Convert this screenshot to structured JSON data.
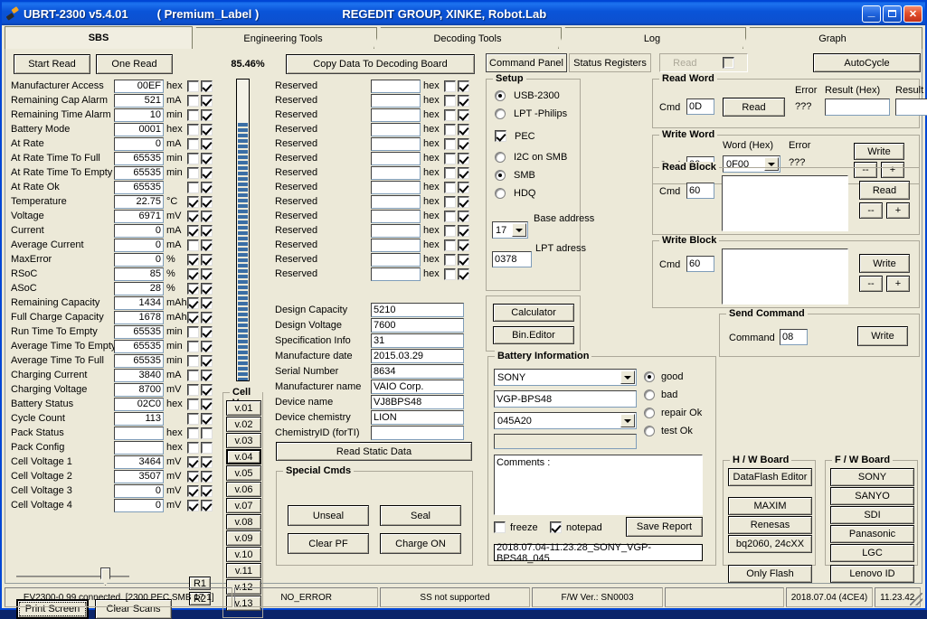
{
  "titlebar": {
    "app_title": "UBRT-2300 v5.4.01",
    "label": "( Premium_Label )",
    "group": "REGEDIT GROUP,  XINKE,  Robot.Lab",
    "minimize": "_",
    "maximize": "❐",
    "close": "✕"
  },
  "tabs": [
    {
      "label": "SBS",
      "active": true
    },
    {
      "label": "Engineering Tools",
      "active": false
    },
    {
      "label": "Decoding Tools",
      "active": false
    },
    {
      "label": "Log",
      "active": false
    },
    {
      "label": "Graph",
      "active": false
    }
  ],
  "toolbar": {
    "start_read": "Start Read",
    "one_read": "One Read",
    "percent": "85.46%",
    "copy_to_decoding": "Copy Data To Decoding Board"
  },
  "progress": {
    "value": 85.46,
    "label": "85.46%"
  },
  "sbs_rows": [
    {
      "name": "Manufacturer Access",
      "value": "00EF",
      "unit": "hex",
      "cb1": false,
      "cb2": true
    },
    {
      "name": "Remaining Cap Alarm",
      "value": "521",
      "unit": "mA",
      "cb1": false,
      "cb2": true
    },
    {
      "name": "Remaining Time Alarm",
      "value": "10",
      "unit": "min",
      "cb1": false,
      "cb2": true
    },
    {
      "name": "Battery Mode",
      "value": "0001",
      "unit": "hex",
      "cb1": false,
      "cb2": true
    },
    {
      "name": "At Rate",
      "value": "0",
      "unit": "mA",
      "cb1": false,
      "cb2": true
    },
    {
      "name": "At Rate Time To Full",
      "value": "65535",
      "unit": "min",
      "cb1": false,
      "cb2": true
    },
    {
      "name": "At Rate Time To Empty",
      "value": "65535",
      "unit": "min",
      "cb1": false,
      "cb2": true
    },
    {
      "name": "At Rate Ok",
      "value": "65535",
      "unit": "",
      "cb1": false,
      "cb2": true
    },
    {
      "name": "Temperature",
      "value": "22.75",
      "unit": "°C",
      "cb1": true,
      "cb2": true
    },
    {
      "name": "Voltage",
      "value": "6971",
      "unit": "mV",
      "cb1": true,
      "cb2": true
    },
    {
      "name": "Current",
      "value": "0",
      "unit": "mA",
      "cb1": true,
      "cb2": true
    },
    {
      "name": "Average Current",
      "value": "0",
      "unit": "mA",
      "cb1": false,
      "cb2": true
    },
    {
      "name": "MaxError",
      "value": "0",
      "unit": "%",
      "cb1": true,
      "cb2": true
    },
    {
      "name": "RSoC",
      "value": "85",
      "unit": "%",
      "cb1": true,
      "cb2": true
    },
    {
      "name": "ASoC",
      "value": "28",
      "unit": "%",
      "cb1": true,
      "cb2": true
    },
    {
      "name": "Remaining Capacity",
      "value": "1434",
      "unit": "mAh",
      "cb1": true,
      "cb2": true
    },
    {
      "name": "Full Charge Capacity",
      "value": "1678",
      "unit": "mAh",
      "cb1": true,
      "cb2": true
    },
    {
      "name": "Run Time To Empty",
      "value": "65535",
      "unit": "min",
      "cb1": false,
      "cb2": true
    },
    {
      "name": "Average Time To Empty",
      "value": "65535",
      "unit": "min",
      "cb1": false,
      "cb2": true
    },
    {
      "name": "Average Time To Full",
      "value": "65535",
      "unit": "min",
      "cb1": false,
      "cb2": true
    },
    {
      "name": "Charging Current",
      "value": "3840",
      "unit": "mA",
      "cb1": false,
      "cb2": true
    },
    {
      "name": "Charging Voltage",
      "value": "8700",
      "unit": "mV",
      "cb1": false,
      "cb2": true
    },
    {
      "name": "Battery Status",
      "value": "02C0",
      "unit": "hex",
      "cb1": false,
      "cb2": true
    },
    {
      "name": "Cycle Count",
      "value": "113",
      "unit": "",
      "cb1": false,
      "cb2": true
    },
    {
      "name": "Pack Status",
      "value": "",
      "unit": "hex",
      "cb1": false,
      "cb2": false
    },
    {
      "name": "Pack Config",
      "value": "",
      "unit": "hex",
      "cb1": false,
      "cb2": false
    },
    {
      "name": "Cell Voltage 1",
      "value": "3464",
      "unit": "mV",
      "cb1": true,
      "cb2": true
    },
    {
      "name": "Cell Voltage 2",
      "value": "3507",
      "unit": "mV",
      "cb1": true,
      "cb2": true
    },
    {
      "name": "Cell Voltage 3",
      "value": "0",
      "unit": "mV",
      "cb1": true,
      "cb2": true
    },
    {
      "name": "Cell Voltage 4",
      "value": "0",
      "unit": "mV",
      "cb1": true,
      "cb2": true
    }
  ],
  "reserved_rows": [
    {
      "name": "Reserved",
      "value": "",
      "unit": "hex",
      "cb1": false,
      "cb2": true
    },
    {
      "name": "Reserved",
      "value": "",
      "unit": "hex",
      "cb1": false,
      "cb2": true
    },
    {
      "name": "Reserved",
      "value": "",
      "unit": "hex",
      "cb1": false,
      "cb2": true
    },
    {
      "name": "Reserved",
      "value": "",
      "unit": "hex",
      "cb1": false,
      "cb2": true
    },
    {
      "name": "Reserved",
      "value": "",
      "unit": "hex",
      "cb1": false,
      "cb2": true
    },
    {
      "name": "Reserved",
      "value": "",
      "unit": "hex",
      "cb1": false,
      "cb2": true
    },
    {
      "name": "Reserved",
      "value": "",
      "unit": "hex",
      "cb1": false,
      "cb2": true
    },
    {
      "name": "Reserved",
      "value": "",
      "unit": "hex",
      "cb1": false,
      "cb2": true
    },
    {
      "name": "Reserved",
      "value": "",
      "unit": "hex",
      "cb1": false,
      "cb2": true
    },
    {
      "name": "Reserved",
      "value": "",
      "unit": "hex",
      "cb1": false,
      "cb2": true
    },
    {
      "name": "Reserved",
      "value": "",
      "unit": "hex",
      "cb1": false,
      "cb2": true
    },
    {
      "name": "Reserved",
      "value": "",
      "unit": "hex",
      "cb1": false,
      "cb2": true
    },
    {
      "name": "Reserved",
      "value": "",
      "unit": "hex",
      "cb1": false,
      "cb2": true
    },
    {
      "name": "Reserved",
      "value": "",
      "unit": "hex",
      "cb1": false,
      "cb2": true
    }
  ],
  "static_data": {
    "rows": [
      {
        "name": "Design Capacity",
        "value": "5210"
      },
      {
        "name": "Design Voltage",
        "value": "7600"
      },
      {
        "name": "Specification Info",
        "value": "31"
      },
      {
        "name": "Manufacture date",
        "value": "2015.03.29"
      },
      {
        "name": "Serial Number",
        "value": "8634"
      },
      {
        "name": "Manufacturer name",
        "value": "VAIO Corp."
      },
      {
        "name": "Device name",
        "value": "VJ8BPS48"
      },
      {
        "name": "Device chemistry",
        "value": "LION"
      },
      {
        "name": "ChemistryID (forTI)",
        "value": ""
      }
    ],
    "read_button": "Read Static Data"
  },
  "cell_v": {
    "caption": "Cell V.",
    "buttons": [
      "v.01",
      "v.02",
      "v.03",
      "v.04",
      "v.05",
      "v.06",
      "v.07",
      "v.08",
      "v.09",
      "v.10",
      "v.11",
      "v.12",
      "v.13"
    ],
    "selected": "v.04"
  },
  "special_cmds": {
    "caption": "Special Cmds",
    "unseal": "Unseal",
    "seal": "Seal",
    "clear_pf": "Clear PF",
    "charge_on": "Charge ON"
  },
  "bottom_left": {
    "print_screen": "Print Screen",
    "clear_scans": "Clear Scans",
    "r1": "R1",
    "r2": "R2"
  },
  "right_tabs": {
    "command_panel": "Command Panel",
    "status_registers": "Status Registers",
    "read_toggle_label": "Read",
    "autocycle": "AutoCycle"
  },
  "setup": {
    "caption": "Setup",
    "options": [
      {
        "label": "USB-2300",
        "type": "radio",
        "checked": true
      },
      {
        "label": "LPT -Philips",
        "type": "radio",
        "checked": false
      },
      {
        "label": "PEC",
        "type": "check",
        "checked": true
      },
      {
        "label": "I2C on SMB",
        "type": "radio",
        "checked": false
      },
      {
        "label": "SMB",
        "type": "radio",
        "checked": true
      },
      {
        "label": "HDQ",
        "type": "radio",
        "checked": false
      }
    ],
    "base_address_value": "17",
    "base_address_label": "Base address",
    "lpt_address_value": "0378",
    "lpt_address_label": "LPT adress",
    "calculator": "Calculator",
    "bin_editor": "Bin.Editor"
  },
  "read_word": {
    "caption": "Read Word",
    "cmd_label": "Cmd",
    "cmd_value": "0D",
    "read_button": "Read",
    "error_label": "Error",
    "error_value": "???",
    "result_hex_label": "Result (Hex)",
    "result_hex_value": "",
    "result_dec_label": "Result (dec)",
    "result_dec_value": ""
  },
  "write_word": {
    "caption": "Write Word",
    "cmd_label": "Cmd",
    "cmd_value": "00",
    "word_label": "Word (Hex)",
    "word_value": "0F00",
    "error_label": "Error",
    "error_value": "???",
    "write_button": "Write",
    "minus": "--",
    "plus": "+"
  },
  "read_block": {
    "caption": "Read Block",
    "cmd_label": "Cmd",
    "cmd_value": "60",
    "content": "",
    "read_button": "Read",
    "minus": "--",
    "plus": "+"
  },
  "write_block": {
    "caption": "Write Block",
    "cmd_label": "Cmd",
    "cmd_value": "60",
    "content": "",
    "write_button": "Write",
    "minus": "--",
    "plus": "+"
  },
  "send_command": {
    "caption": "Send Command",
    "command_label": "Command",
    "command_value": "08",
    "write_button": "Write"
  },
  "battery_info": {
    "caption": "Battery Information",
    "maker": "SONY",
    "model": "VGP-BPS48",
    "code": "045A20",
    "extra": "",
    "comments": "Comments :",
    "states": [
      {
        "label": "good",
        "checked": true
      },
      {
        "label": "bad",
        "checked": false
      },
      {
        "label": "repair Ok",
        "checked": false
      },
      {
        "label": "test    Ok",
        "checked": false
      }
    ],
    "freeze_label": "freeze",
    "freeze_checked": false,
    "notepad_label": "notepad",
    "notepad_checked": true,
    "save_report": "Save Report",
    "filename": "2018.07.04-11.23.28_SONY_VGP-BPS48_045"
  },
  "hw_board": {
    "caption": "H / W   Board",
    "buttons": [
      "DataFlash Editor",
      "MAXIM",
      "Renesas",
      "bq2060, 24cXX",
      "Only Flash"
    ]
  },
  "fw_board": {
    "caption": "F / W   Board",
    "buttons": [
      "SONY",
      "SANYO",
      "SDI",
      "Panasonic",
      "LGC",
      "Lenovo ID"
    ]
  },
  "statusbar": {
    "connection": "EV2300-0.99 connected. [2300  PEC  SMB  17 1]",
    "error": "NO_ERROR",
    "ss": "SS not supported",
    "fw_ver": "F/W Ver.: SN0003",
    "blank": "",
    "date": "2018.07.04  (4CE4)",
    "time": "11.23.42"
  }
}
